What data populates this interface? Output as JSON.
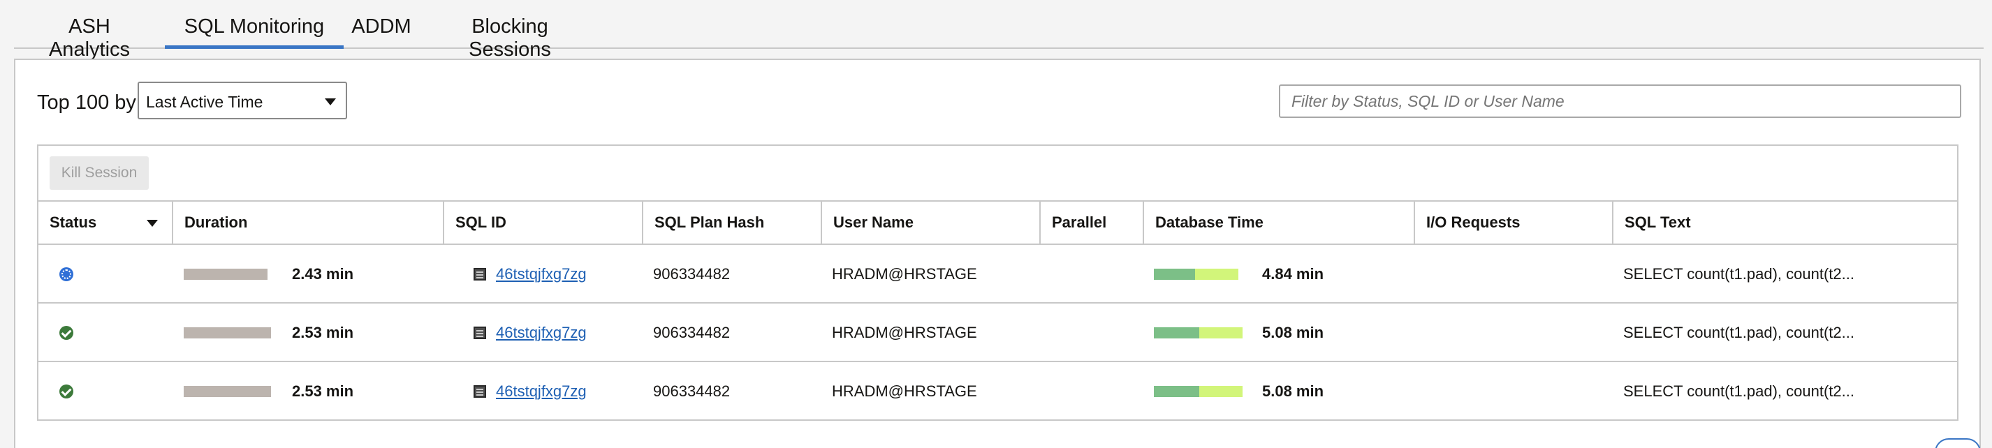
{
  "tabs": [
    {
      "label": "ASH Analytics",
      "active": false
    },
    {
      "label": "SQL Monitoring",
      "active": true
    },
    {
      "label": "ADDM",
      "active": false
    },
    {
      "label": "Blocking Sessions",
      "active": false
    }
  ],
  "controls": {
    "top_label": "Top 100 by",
    "sort_select_value": "Last Active Time",
    "filter_placeholder": "Filter by Status, SQL ID or User Name"
  },
  "toolbar": {
    "kill_session_label": "Kill Session",
    "kill_session_enabled": false
  },
  "table": {
    "columns": [
      "Status",
      "Duration",
      "SQL ID",
      "SQL Plan Hash",
      "User Name",
      "Parallel",
      "Database Time",
      "I/O Requests",
      "SQL Text"
    ],
    "rows": [
      {
        "status": "running",
        "status_icon": "running-spinner-icon",
        "duration": "2.43 min",
        "duration_fraction": 0.96,
        "sql_id": "46tstqjfxg7zg",
        "plan_hash": "906334482",
        "user": "HRADM@HRSTAGE",
        "parallel": "",
        "db_time": "4.84 min",
        "db_cpu_fraction": 0.49,
        "io_requests": "",
        "sql_text": "SELECT count(t1.pad), count(t2..."
      },
      {
        "status": "completed",
        "status_icon": "check-circle-icon",
        "duration": "2.53 min",
        "duration_fraction": 1.0,
        "sql_id": "46tstqjfxg7zg",
        "plan_hash": "906334482",
        "user": "HRADM@HRSTAGE",
        "parallel": "",
        "db_time": "5.08 min",
        "db_cpu_fraction": 0.51,
        "io_requests": "",
        "sql_text": "SELECT count(t1.pad), count(t2..."
      },
      {
        "status": "completed",
        "status_icon": "check-circle-icon",
        "duration": "2.53 min",
        "duration_fraction": 1.0,
        "sql_id": "46tstqjfxg7zg",
        "plan_hash": "906334482",
        "user": "HRADM@HRSTAGE",
        "parallel": "",
        "db_time": "5.08 min",
        "db_cpu_fraction": 0.51,
        "io_requests": "",
        "sql_text": "SELECT count(t1.pad), count(t2..."
      }
    ]
  },
  "colors": {
    "accent": "#3a76c5",
    "link": "#1d5fb3",
    "duration_bar": "#bcb4ae",
    "db_cpu": "#7cbf87",
    "db_wait": "#d2f57a",
    "status_running": "#2f6fd6",
    "status_completed": "#3c7a3a"
  }
}
